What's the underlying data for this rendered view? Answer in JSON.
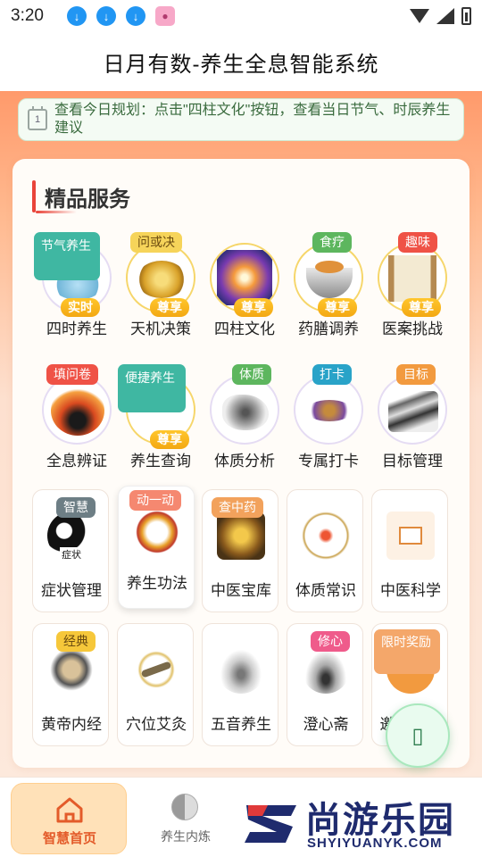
{
  "status_bar": {
    "time": "3:20"
  },
  "header": {
    "title": "日月有数-养生全息智能系统"
  },
  "notice": {
    "text": "查看今日规划：点击\"四柱文化\"按钮，查看当日节气、时辰养生建议"
  },
  "services": {
    "title": "精品服务",
    "row1": [
      {
        "label": "四时养生",
        "tag": "节气养生",
        "badge": "实时"
      },
      {
        "label": "天机决策",
        "tag": "问或决",
        "badge": "尊享"
      },
      {
        "label": "四柱文化",
        "tag": "",
        "badge": "尊享"
      },
      {
        "label": "药膳调养",
        "tag": "食疗",
        "badge": "尊享"
      },
      {
        "label": "医案挑战",
        "tag": "趣味",
        "badge": "尊享"
      }
    ],
    "row2": [
      {
        "label": "全息辨证",
        "tag": "填问卷",
        "badge": ""
      },
      {
        "label": "养生查询",
        "tag": "便捷养生",
        "badge": "尊享"
      },
      {
        "label": "体质分析",
        "tag": "体质",
        "badge": ""
      },
      {
        "label": "专属打卡",
        "tag": "打卡",
        "badge": ""
      },
      {
        "label": "目标管理",
        "tag": "目标",
        "badge": ""
      }
    ],
    "row3": [
      {
        "label": "症状管理",
        "tag": "智慧"
      },
      {
        "label": "养生功法",
        "tag": "动一动"
      },
      {
        "label": "中医宝库",
        "tag": "查中药"
      },
      {
        "label": "体质常识",
        "tag": ""
      },
      {
        "label": "中医科学",
        "tag": ""
      }
    ],
    "row4": [
      {
        "label": "黄帝内经",
        "tag": "经典"
      },
      {
        "label": "穴位艾灸",
        "tag": ""
      },
      {
        "label": "五音养生",
        "tag": ""
      },
      {
        "label": "澄心斋",
        "tag": "修心"
      },
      {
        "label": "邀",
        "tag": "限时奖励"
      }
    ],
    "art_text": {
      "symptom": "症状"
    }
  },
  "bottom_nav": {
    "home": "智慧首页",
    "inner": "养生内炼"
  },
  "watermark": {
    "brand": "尚游乐园",
    "domain": "SHYIYUANYK.COM"
  },
  "colors": {
    "accent": "#e35b2a",
    "title_bar": "#e9443a"
  },
  "icons": [
    "download-icon",
    "wifi-icon",
    "signal-icon",
    "battery-icon",
    "calendar-icon",
    "home-icon",
    "yinyang-icon"
  ]
}
